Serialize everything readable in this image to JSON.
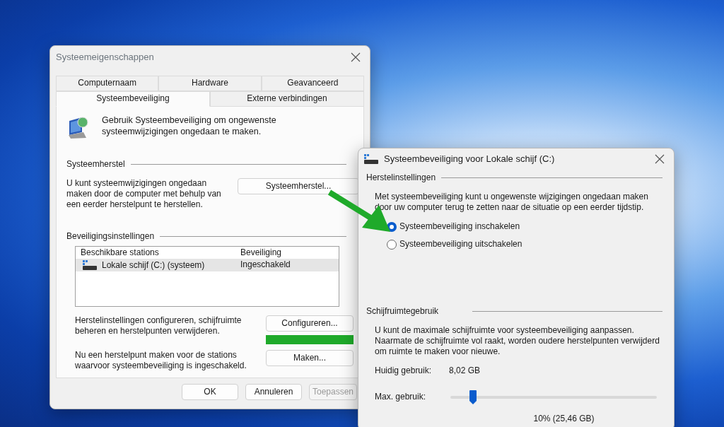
{
  "dialog": {
    "title": "Systeemeigenschappen",
    "tab_rows": [
      [
        {
          "label": "Computernaam",
          "selected": false
        },
        {
          "label": "Hardware",
          "selected": false
        },
        {
          "label": "Geavanceerd",
          "selected": false
        }
      ],
      [
        {
          "label": "Systeembeveiliging",
          "selected": true
        },
        {
          "label": "Externe verbindingen",
          "selected": false
        }
      ]
    ],
    "intro": "Gebruik Systeembeveiliging om ongewenste systeemwijzigingen ongedaan te maken.",
    "restore_group": {
      "title": "Systeemherstel",
      "text": "U kunt systeemwijzigingen ongedaan maken door de computer met behulp van een eerder herstelpunt te herstellen.",
      "button": "Systeemherstel..."
    },
    "protection_group": {
      "title": "Beveiligingsinstellingen",
      "columns": [
        "Beschikbare stations",
        "Beveiliging"
      ],
      "rows": [
        {
          "cells": [
            "Lokale schijf (C:) (systeem)",
            "Ingeschakeld"
          ],
          "selected": true
        }
      ],
      "actions": [
        {
          "text": "Herstelinstellingen configureren, schijfruimte beheren en herstelpunten verwijderen.",
          "button": "Configureren...",
          "highlighted": true
        },
        {
          "text": "Nu een herstelpunt maken voor de stations waarvoor systeembeveiliging is ingeschakeld.",
          "button": "Maken...",
          "highlighted": false
        }
      ]
    },
    "buttons": [
      {
        "label": "OK",
        "disabled": false
      },
      {
        "label": "Annuleren",
        "disabled": false
      },
      {
        "label": "Toepassen",
        "disabled": true
      }
    ]
  },
  "drive_dialog": {
    "title": "Systeembeveiliging voor Lokale schijf (C:)",
    "restore_settings": {
      "title": "Herstelinstellingen",
      "text": "Met systeembeveiliging kunt u ongewenste wijzigingen ongedaan maken door uw computer terug te zetten naar de situatie op een eerder tijdstip.",
      "options": [
        {
          "label": "Systeembeveiliging inschakelen",
          "selected": true
        },
        {
          "label": "Systeembeveiliging uitschakelen",
          "selected": false
        }
      ]
    },
    "disk_usage": {
      "title": "Schijfruimtegebruik",
      "text": "U kunt de maximale schijfruimte voor systeembeveiliging aanpassen. Naarmate de schijfruimte vol raakt, worden oudere herstelpunten verwijderd om ruimte te maken voor nieuwe.",
      "current_label": "Huidig gebruik:",
      "current_value": "8,02 GB",
      "max_label": "Max. gebruik:",
      "slider": {
        "level": 0.11
      },
      "slider_reading": "10% (25,46 GB)"
    }
  }
}
